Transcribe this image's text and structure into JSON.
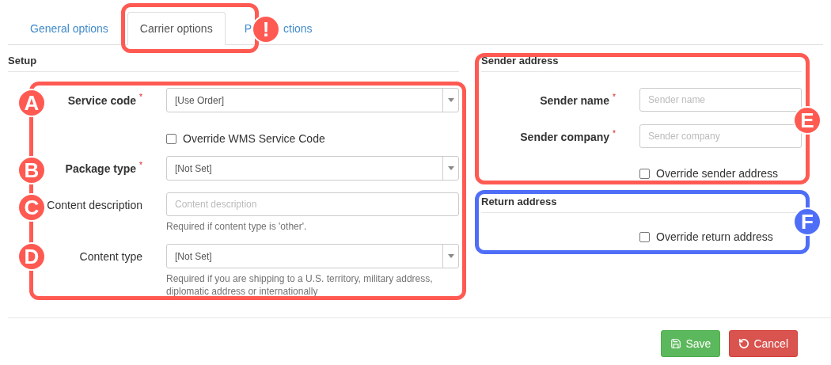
{
  "tabs": [
    {
      "label_parts": [
        "General options"
      ],
      "selected": false
    },
    {
      "label_parts": [
        "Carrier options"
      ],
      "selected": true
    },
    {
      "label_parts": [
        "P",
        "ctions"
      ],
      "selected": false
    }
  ],
  "setup": {
    "title": "Setup",
    "fields": [
      {
        "kind": "select",
        "label": "Service code",
        "required": true,
        "mark": "*",
        "value": "[Use Order]"
      },
      {
        "kind": "checkbox",
        "label": "Override WMS Service Code",
        "checked": false
      },
      {
        "kind": "select",
        "label": "Package type",
        "required": true,
        "mark": "*",
        "value": "[Not Set]"
      },
      {
        "kind": "text",
        "label": "Content description",
        "required": false,
        "placeholder": "Content description",
        "help": "Required if content type is 'other'."
      },
      {
        "kind": "select",
        "label": "Content type",
        "required": false,
        "value": "[Not Set]",
        "help": "Required if you are shipping to a U.S. territory, military address, diplomatic address or internationally"
      }
    ]
  },
  "sender_address": {
    "title": "Sender address",
    "fields": [
      {
        "kind": "text",
        "label": "Sender name",
        "required": true,
        "mark": "*",
        "placeholder": "Sender name"
      },
      {
        "kind": "text",
        "label": "Sender company",
        "required": true,
        "mark": "*",
        "placeholder": "Sender company"
      },
      {
        "kind": "checkbox",
        "label": "Override sender address",
        "checked": false
      }
    ]
  },
  "return_address": {
    "title": "Return address",
    "fields": [
      {
        "kind": "checkbox",
        "label": "Override return address",
        "checked": false
      }
    ]
  },
  "buttons": [
    {
      "kind": "save",
      "label": "Save"
    },
    {
      "kind": "cancel",
      "label": "Cancel"
    }
  ],
  "annotations": [
    {
      "kind": "frame",
      "color": "#ff5a52"
    },
    {
      "kind": "frame",
      "color": "#ff5a52"
    },
    {
      "kind": "frame",
      "color": "#ff5a52"
    },
    {
      "kind": "frame",
      "color": "#4f6ef7"
    },
    {
      "kind": "marker",
      "text": "!",
      "color": "#ff5a52"
    },
    {
      "kind": "marker",
      "text": "A",
      "color": "#ff5a52"
    },
    {
      "kind": "marker",
      "text": "B",
      "color": "#ff5a52"
    },
    {
      "kind": "marker",
      "text": "C",
      "color": "#ff5a52"
    },
    {
      "kind": "marker",
      "text": "D",
      "color": "#ff5a52"
    },
    {
      "kind": "marker",
      "text": "E",
      "color": "#ff5a52"
    },
    {
      "kind": "marker",
      "text": "F",
      "color": "#4f6ef7"
    }
  ]
}
